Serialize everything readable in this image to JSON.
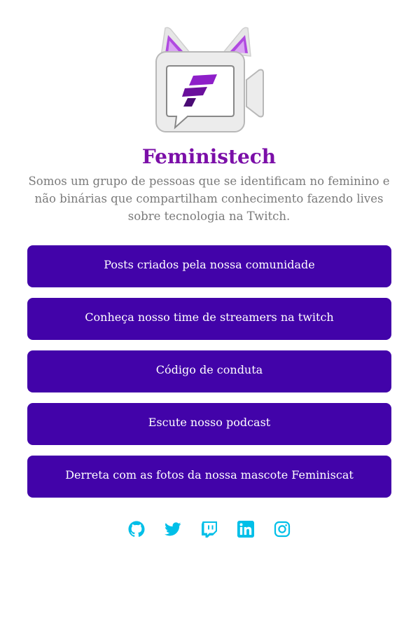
{
  "profile": {
    "name": "Feministech",
    "description": "Somos um grupo de pessoas que se identificam no feminino e não binárias que compartilham conhecimento fazendo lives sobre tecnologia na Twitch.",
    "logo_icon": "camera-cat-ears-logo-icon"
  },
  "links": [
    {
      "label": "Posts criados pela nossa comunidade"
    },
    {
      "label": "Conheça nosso time de streamers na twitch"
    },
    {
      "label": "Código de conduta"
    },
    {
      "label": "Escute nosso podcast"
    },
    {
      "label": "Derreta com as fotos da nossa mascote Feminiscat"
    }
  ],
  "social": [
    {
      "icon": "github-icon"
    },
    {
      "icon": "twitter-icon"
    },
    {
      "icon": "twitch-icon"
    },
    {
      "icon": "linkedin-icon"
    },
    {
      "icon": "instagram-icon"
    }
  ],
  "colors": {
    "button_bg": "#4203a9",
    "title": "#7b0fa8",
    "icon": "#00bfe8",
    "text": "#7a7a7a"
  }
}
